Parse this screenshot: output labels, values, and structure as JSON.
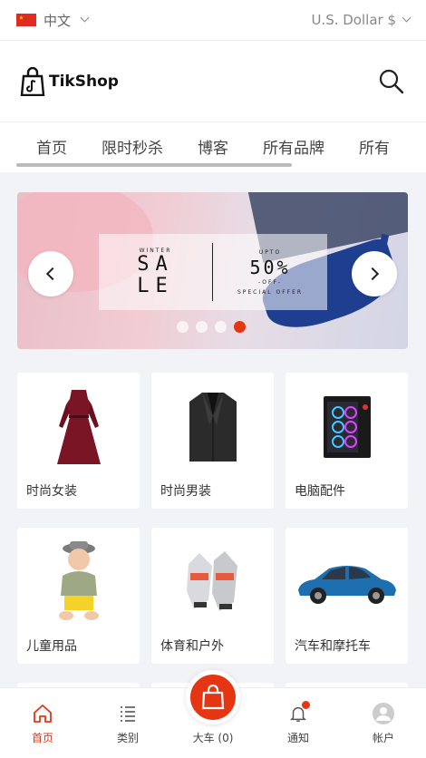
{
  "topbar": {
    "language": "中文",
    "currency": "U.S. Dollar $"
  },
  "header": {
    "logo_text": "TikShop"
  },
  "nav": {
    "items": [
      "首页",
      "限时秒杀",
      "博客",
      "所有品牌",
      "所有"
    ]
  },
  "banner": {
    "left_top": "WINTER",
    "left_line1": "SA",
    "left_line2": "LE",
    "right_top": "UPTO",
    "right_big": "50%",
    "right_off": "-OFF-",
    "right_bottom": "SPECIAL OFFER",
    "slides": 4,
    "active_slide": 4
  },
  "categories": [
    {
      "label": "时尚女装",
      "icon": "dress-icon"
    },
    {
      "label": "时尚男装",
      "icon": "suit-jacket-icon"
    },
    {
      "label": "电脑配件",
      "icon": "pc-case-icon"
    },
    {
      "label": "儿童用品",
      "icon": "child-icon"
    },
    {
      "label": "体育和户外",
      "icon": "gloves-icon"
    },
    {
      "label": "汽车和摩托车",
      "icon": "car-icon"
    }
  ],
  "bottom_nav": {
    "home": "首页",
    "categories": "类别",
    "cart": "大车 (0)",
    "notifications": "通知",
    "account": "帐户"
  },
  "colors": {
    "accent": "#e53512"
  }
}
